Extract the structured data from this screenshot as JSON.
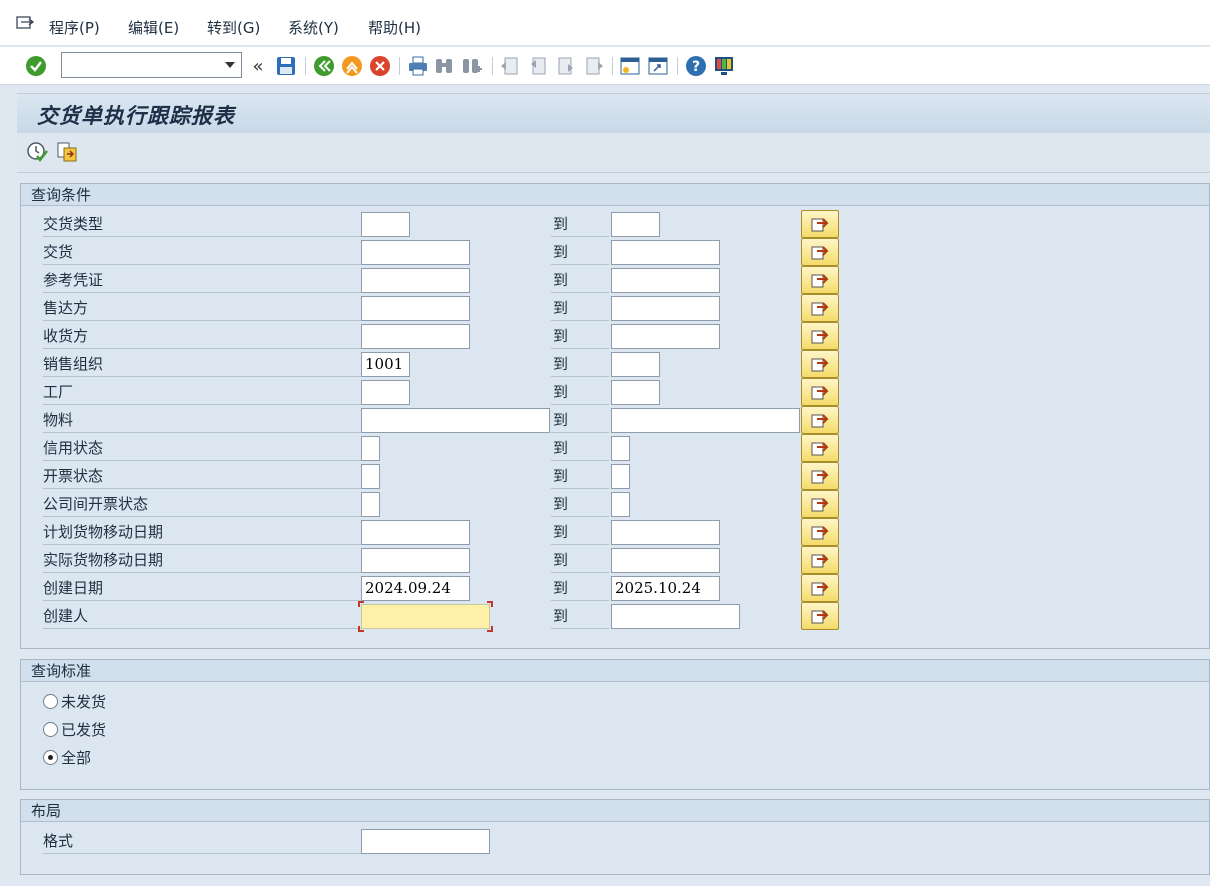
{
  "menu": {
    "items": [
      {
        "label": "程序(P)"
      },
      {
        "label": "编辑(E)"
      },
      {
        "label": "转到(G)"
      },
      {
        "label": "系统(Y)"
      },
      {
        "label": "帮助(H)"
      }
    ]
  },
  "toolbar": {
    "command_field_value": "",
    "icons": [
      "enter-check-icon",
      "save-icon",
      "back-icon",
      "exit-icon",
      "cancel-icon",
      "print-icon",
      "find-icon",
      "find-next-icon",
      "first-page-icon",
      "prev-page-icon",
      "next-page-icon",
      "last-page-icon",
      "new-session-icon",
      "shortcut-icon",
      "help-icon",
      "layout-icon"
    ]
  },
  "page": {
    "title": "交货单执行跟踪报表"
  },
  "query_conditions": {
    "title": "查询条件",
    "to_label": "到",
    "rows": [
      {
        "label": "交货类型",
        "from": "",
        "to": ""
      },
      {
        "label": "交货",
        "from": "",
        "to": ""
      },
      {
        "label": "参考凭证",
        "from": "",
        "to": ""
      },
      {
        "label": "售达方",
        "from": "",
        "to": ""
      },
      {
        "label": "收货方",
        "from": "",
        "to": ""
      },
      {
        "label": "销售组织",
        "from": "1001",
        "to": ""
      },
      {
        "label": "工厂",
        "from": "",
        "to": ""
      },
      {
        "label": "物料",
        "from": "",
        "to": ""
      },
      {
        "label": "信用状态",
        "from": "",
        "to": ""
      },
      {
        "label": "开票状态",
        "from": "",
        "to": ""
      },
      {
        "label": "公司间开票状态",
        "from": "",
        "to": ""
      },
      {
        "label": "计划货物移动日期",
        "from": "",
        "to": ""
      },
      {
        "label": "实际货物移动日期",
        "from": "",
        "to": ""
      },
      {
        "label": "创建日期",
        "from": "2024.09.24",
        "to": "2025.10.24"
      },
      {
        "label": "创建人",
        "from": "",
        "to": ""
      }
    ]
  },
  "query_criteria": {
    "title": "查询标准",
    "options": [
      {
        "label": "未发货",
        "selected": false
      },
      {
        "label": "已发货",
        "selected": false
      },
      {
        "label": "全部",
        "selected": true
      }
    ]
  },
  "layout_group": {
    "title": "布局",
    "format_label": "格式",
    "format_value": ""
  }
}
